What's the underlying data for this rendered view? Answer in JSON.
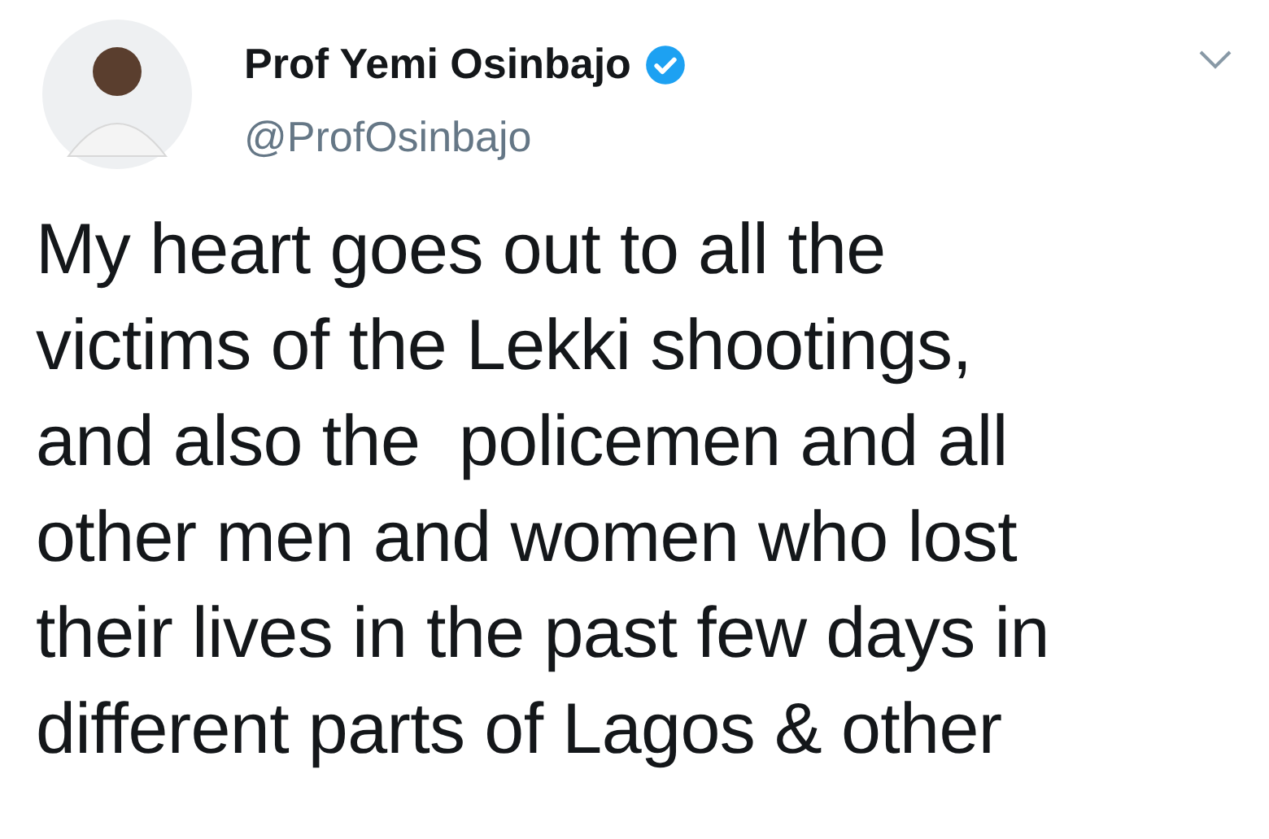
{
  "author": {
    "name": "Prof Yemi Osinbajo",
    "verified": true,
    "handle": "@ProfOsinbajo"
  },
  "tweet": {
    "text": "My heart goes out to all the\nvictims of the Lekki shootings,\nand also the  policemen and all\nother men and women who lost\ntheir lives in the past few days in\ndifferent parts of Lagos & other"
  }
}
